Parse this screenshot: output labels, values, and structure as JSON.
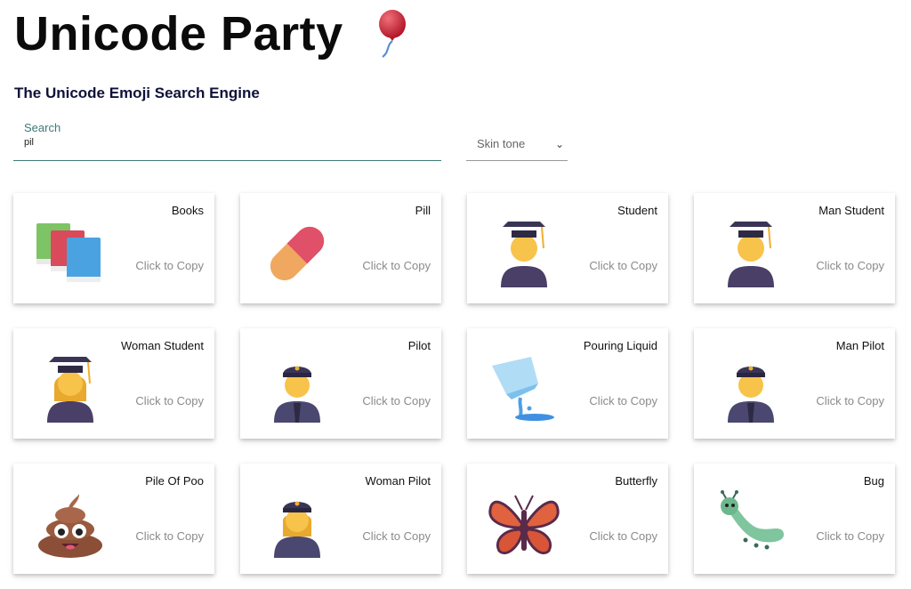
{
  "header": {
    "title": "Unicode Party",
    "subtitle": "The Unicode Emoji Search Engine"
  },
  "search": {
    "label": "Search",
    "value": "pil"
  },
  "skin_tone": {
    "label": "Skin tone"
  },
  "results": [
    {
      "name": "Books",
      "action": "Click to Copy",
      "icon": "books-icon"
    },
    {
      "name": "Pill",
      "action": "Click to Copy",
      "icon": "pill-icon"
    },
    {
      "name": "Student",
      "action": "Click to Copy",
      "icon": "student-icon"
    },
    {
      "name": "Man Student",
      "action": "Click to Copy",
      "icon": "man-student-icon"
    },
    {
      "name": "Woman Student",
      "action": "Click to Copy",
      "icon": "woman-student-icon"
    },
    {
      "name": "Pilot",
      "action": "Click to Copy",
      "icon": "pilot-icon"
    },
    {
      "name": "Pouring Liquid",
      "action": "Click to Copy",
      "icon": "pouring-liquid-icon"
    },
    {
      "name": "Man Pilot",
      "action": "Click to Copy",
      "icon": "man-pilot-icon"
    },
    {
      "name": "Pile Of Poo",
      "action": "Click to Copy",
      "icon": "pile-of-poo-icon"
    },
    {
      "name": "Woman Pilot",
      "action": "Click to Copy",
      "icon": "woman-pilot-icon"
    },
    {
      "name": "Butterfly",
      "action": "Click to Copy",
      "icon": "butterfly-icon"
    },
    {
      "name": "Bug",
      "action": "Click to Copy",
      "icon": "bug-icon"
    }
  ]
}
